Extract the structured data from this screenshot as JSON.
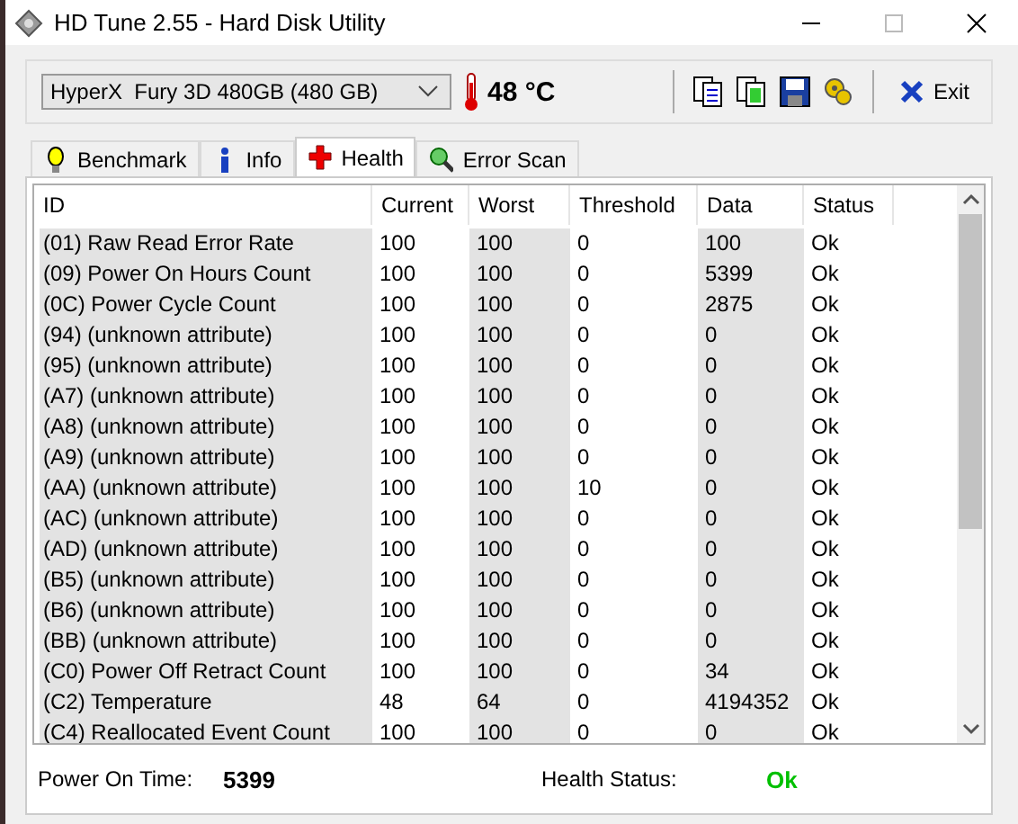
{
  "window": {
    "title": "HD Tune 2.55 - Hard Disk Utility"
  },
  "toolbar": {
    "drive": "HyperX  Fury 3D 480GB (480 GB)",
    "temperature": "48 °C",
    "exit": "Exit"
  },
  "tabs": [
    {
      "label": "Benchmark",
      "kind": "bulb",
      "selected": false
    },
    {
      "label": "Info",
      "kind": "info",
      "selected": false
    },
    {
      "label": "Health",
      "kind": "cross",
      "selected": true
    },
    {
      "label": "Error Scan",
      "kind": "magnifier",
      "selected": false
    }
  ],
  "table": {
    "columns": [
      "ID",
      "Current",
      "Worst",
      "Threshold",
      "Data",
      "Status"
    ],
    "rows": [
      [
        "(01) Raw Read Error Rate",
        "100",
        "100",
        "0",
        "100",
        "Ok"
      ],
      [
        "(09) Power On Hours Count",
        "100",
        "100",
        "0",
        "5399",
        "Ok"
      ],
      [
        "(0C) Power Cycle Count",
        "100",
        "100",
        "0",
        "2875",
        "Ok"
      ],
      [
        "(94) (unknown attribute)",
        "100",
        "100",
        "0",
        "0",
        "Ok"
      ],
      [
        "(95) (unknown attribute)",
        "100",
        "100",
        "0",
        "0",
        "Ok"
      ],
      [
        "(A7) (unknown attribute)",
        "100",
        "100",
        "0",
        "0",
        "Ok"
      ],
      [
        "(A8) (unknown attribute)",
        "100",
        "100",
        "0",
        "0",
        "Ok"
      ],
      [
        "(A9) (unknown attribute)",
        "100",
        "100",
        "0",
        "0",
        "Ok"
      ],
      [
        "(AA) (unknown attribute)",
        "100",
        "100",
        "10",
        "0",
        "Ok"
      ],
      [
        "(AC) (unknown attribute)",
        "100",
        "100",
        "0",
        "0",
        "Ok"
      ],
      [
        "(AD) (unknown attribute)",
        "100",
        "100",
        "0",
        "0",
        "Ok"
      ],
      [
        "(B5) (unknown attribute)",
        "100",
        "100",
        "0",
        "0",
        "Ok"
      ],
      [
        "(B6) (unknown attribute)",
        "100",
        "100",
        "0",
        "0",
        "Ok"
      ],
      [
        "(BB) (unknown attribute)",
        "100",
        "100",
        "0",
        "0",
        "Ok"
      ],
      [
        "(C0) Power Off Retract Count",
        "100",
        "100",
        "0",
        "34",
        "Ok"
      ],
      [
        "(C2) Temperature",
        "48",
        "64",
        "0",
        "4194352",
        "Ok"
      ],
      [
        "(C4) Reallocated Event Count",
        "100",
        "100",
        "0",
        "0",
        "Ok"
      ]
    ]
  },
  "summary": {
    "power_on_label": "Power On Time:",
    "power_on_value": "5399",
    "health_label": "Health Status:",
    "health_value": "Ok"
  }
}
